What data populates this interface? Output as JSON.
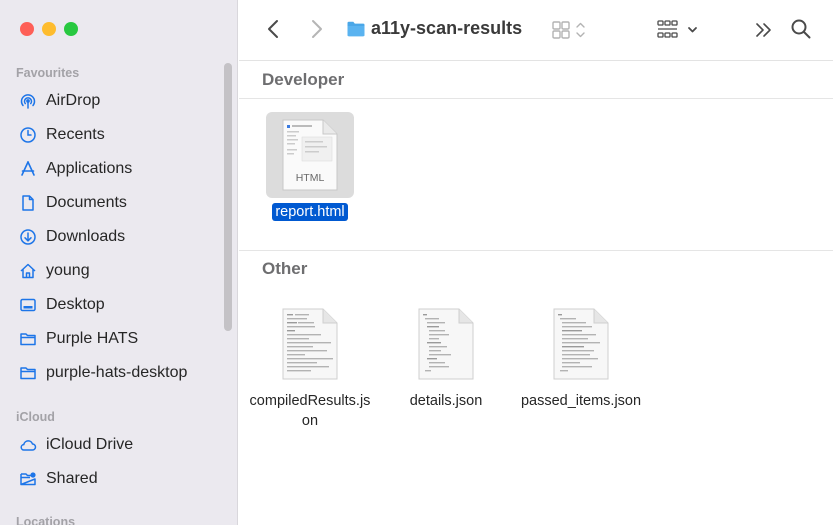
{
  "window": {
    "title": "a11y-scan-results"
  },
  "sidebar": {
    "favourites_title": "Favourites",
    "favourites": [
      {
        "label": "AirDrop",
        "icon": "airdrop-icon"
      },
      {
        "label": "Recents",
        "icon": "clock-icon"
      },
      {
        "label": "Applications",
        "icon": "applications-icon"
      },
      {
        "label": "Documents",
        "icon": "document-icon"
      },
      {
        "label": "Downloads",
        "icon": "download-icon"
      },
      {
        "label": "young",
        "icon": "home-icon"
      },
      {
        "label": "Desktop",
        "icon": "desktop-icon"
      },
      {
        "label": "Purple HATS",
        "icon": "folder-icon"
      },
      {
        "label": "purple-hats-desktop",
        "icon": "folder-icon"
      }
    ],
    "icloud_title": "iCloud",
    "icloud": [
      {
        "label": "iCloud Drive",
        "icon": "cloud-icon"
      },
      {
        "label": "Shared",
        "icon": "shared-folder-icon"
      }
    ],
    "locations_title": "Locations"
  },
  "toolbar": {
    "title": "a11y-scan-results",
    "icons": [
      "back-icon",
      "forward-icon",
      "folder-icon",
      "view-toggle-icon",
      "group-icon",
      "more-icon",
      "search-icon"
    ]
  },
  "content": {
    "groups": [
      {
        "title": "Developer",
        "files": [
          {
            "name": "report.html",
            "kind": "HTML",
            "selected": true
          }
        ]
      },
      {
        "title": "Other",
        "files": [
          {
            "name": "compiledResults.json",
            "selected": false
          },
          {
            "name": "details.json",
            "selected": false
          },
          {
            "name": "passed_items.json",
            "selected": false
          }
        ]
      }
    ]
  },
  "colors": {
    "accent": "#0059d1",
    "sidebar_icon": "#1d75e8",
    "sidebar_bg": "#ebe9ef",
    "traffic_red": "#fe5f57",
    "traffic_yellow": "#febc2e",
    "traffic_green": "#28c840"
  }
}
